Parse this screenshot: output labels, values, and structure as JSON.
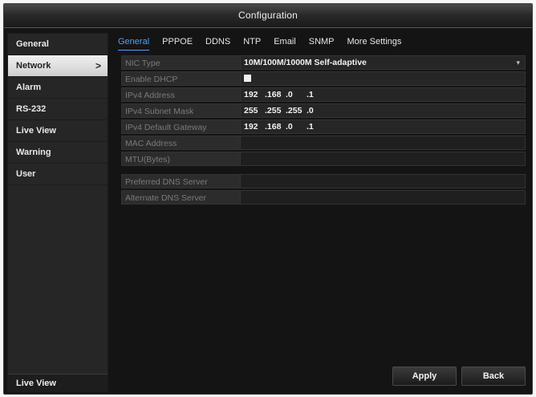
{
  "window": {
    "title": "Configuration"
  },
  "sidebar": {
    "items": [
      {
        "label": "General",
        "active": false
      },
      {
        "label": "Network",
        "active": true,
        "chevron": ">"
      },
      {
        "label": "Alarm",
        "active": false
      },
      {
        "label": "RS-232",
        "active": false
      },
      {
        "label": "Live View",
        "active": false
      },
      {
        "label": "Warning",
        "active": false
      },
      {
        "label": "User",
        "active": false
      }
    ],
    "bottom_label": "Live View"
  },
  "tabs": [
    {
      "label": "General",
      "active": true
    },
    {
      "label": "PPPOE",
      "active": false
    },
    {
      "label": "DDNS",
      "active": false
    },
    {
      "label": "NTP",
      "active": false
    },
    {
      "label": "Email",
      "active": false
    },
    {
      "label": "SNMP",
      "active": false
    },
    {
      "label": "More Settings",
      "active": false
    }
  ],
  "form": {
    "nic_type": {
      "label": "NIC Type",
      "value": "10M/100M/1000M Self-adaptive",
      "arrow": "▾"
    },
    "enable_dhcp": {
      "label": "Enable DHCP",
      "checked": false
    },
    "ipv4_address": {
      "label": "IPv4 Address",
      "octets": [
        "192",
        ".168",
        ".0",
        ".1"
      ]
    },
    "ipv4_subnet": {
      "label": "IPv4 Subnet Mask",
      "octets": [
        "255",
        ".255",
        ".255",
        ".0"
      ]
    },
    "ipv4_gateway": {
      "label": "IPv4 Default Gateway",
      "octets": [
        "192",
        ".168",
        ".0",
        ".1"
      ]
    },
    "mac_address": {
      "label": "MAC Address",
      "value": ""
    },
    "mtu": {
      "label": "MTU(Bytes)",
      "value": ""
    },
    "preferred_dns": {
      "label": "Preferred DNS Server",
      "value": ""
    },
    "alternate_dns": {
      "label": "Alternate DNS Server",
      "value": ""
    }
  },
  "buttons": {
    "apply": "Apply",
    "back": "Back"
  },
  "colors": {
    "accent": "#4ea0ff",
    "background": "#141414",
    "panel": "#262626"
  }
}
